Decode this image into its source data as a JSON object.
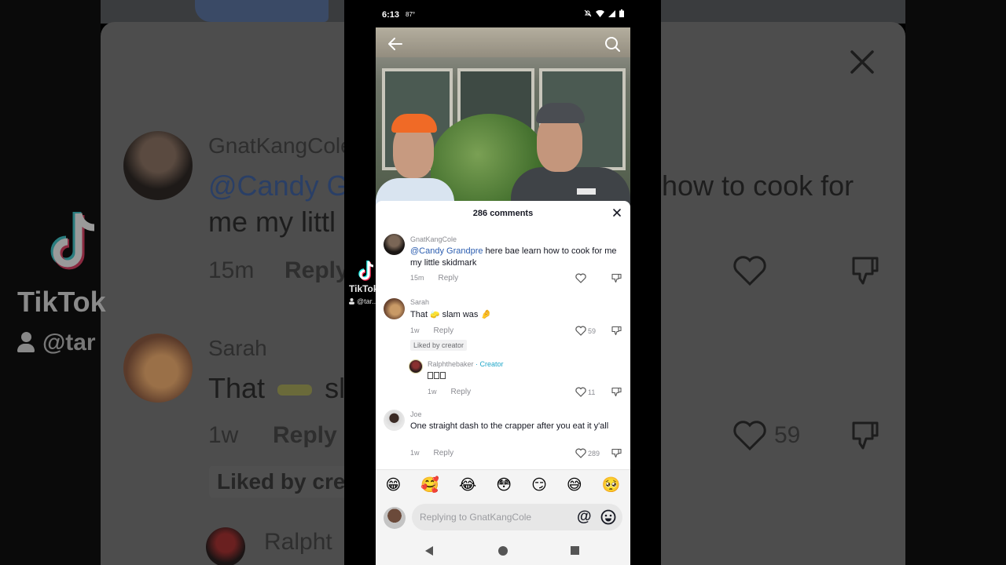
{
  "status_bar": {
    "time": "6:13",
    "temperature": "87°",
    "icons": [
      "notifications-off-icon",
      "wifi-icon",
      "signal-icon",
      "battery-icon"
    ]
  },
  "video": {
    "back_icon": "arrow-left-icon",
    "search_icon": "search-icon"
  },
  "watermark": {
    "brand": "TikTok",
    "handle": "@tar...edby"
  },
  "comments_sheet": {
    "title": "286 comments",
    "close_icon": "close-icon",
    "comments": [
      {
        "username": "GnatKangCole",
        "mention": "@Candy Grandpre",
        "text": " here bae learn how to cook for me my little skidmark",
        "time": "15m",
        "reply_label": "Reply",
        "likes": ""
      },
      {
        "username": "Sarah",
        "text_before": "That ",
        "emoji_1": "🧽",
        "text_middle": " slam was ",
        "emoji_2": "🤌",
        "time": "1w",
        "reply_label": "Reply",
        "likes": "59",
        "badge": "Liked by creator"
      },
      {
        "username": "Ralphthebaker",
        "creator_label": " · Creator",
        "text": "",
        "missing_glyph_count": 3,
        "time": "1w",
        "reply_label": "Reply",
        "likes": "11"
      },
      {
        "username": "Joe",
        "text": "One straight dash to the crapper after you eat it y'all",
        "time": "1w",
        "reply_label": "Reply",
        "likes": "289"
      }
    ]
  },
  "emoji_bar": [
    "😁",
    "🥰",
    "😂",
    "😳",
    "😏",
    "😅",
    "🥺"
  ],
  "composer": {
    "placeholder": "Replying to GnatKangCole",
    "value": "",
    "mention_button": "@",
    "emoji_icon": "emoji-icon"
  },
  "navigation": {
    "back": "nav-back-icon",
    "home": "nav-home-icon",
    "recents": "nav-recents-icon"
  },
  "background_blur": {
    "comment1_user": "GnatKangCole",
    "comment1_mention": "@Candy G",
    "comment1_line2": "me my littl",
    "comment1_right": "how to cook for",
    "comment1_time": "15m",
    "comment1_reply": "Reply",
    "comment2_user": "Sarah",
    "comment2_text": "That",
    "comment2_text_tail": "sl",
    "comment2_time": "1w",
    "comment2_reply": "Reply",
    "comment2_likes": "59",
    "comment2_badge": "Liked by cre",
    "comment3_user": "Ralpht",
    "brand": "TikTok",
    "handle": "@tar"
  },
  "colors": {
    "mention_blue": "#2b5db0",
    "creator_cyan": "#20a7c9",
    "text_primary": "#161823",
    "text_secondary": "#8a8b91"
  }
}
